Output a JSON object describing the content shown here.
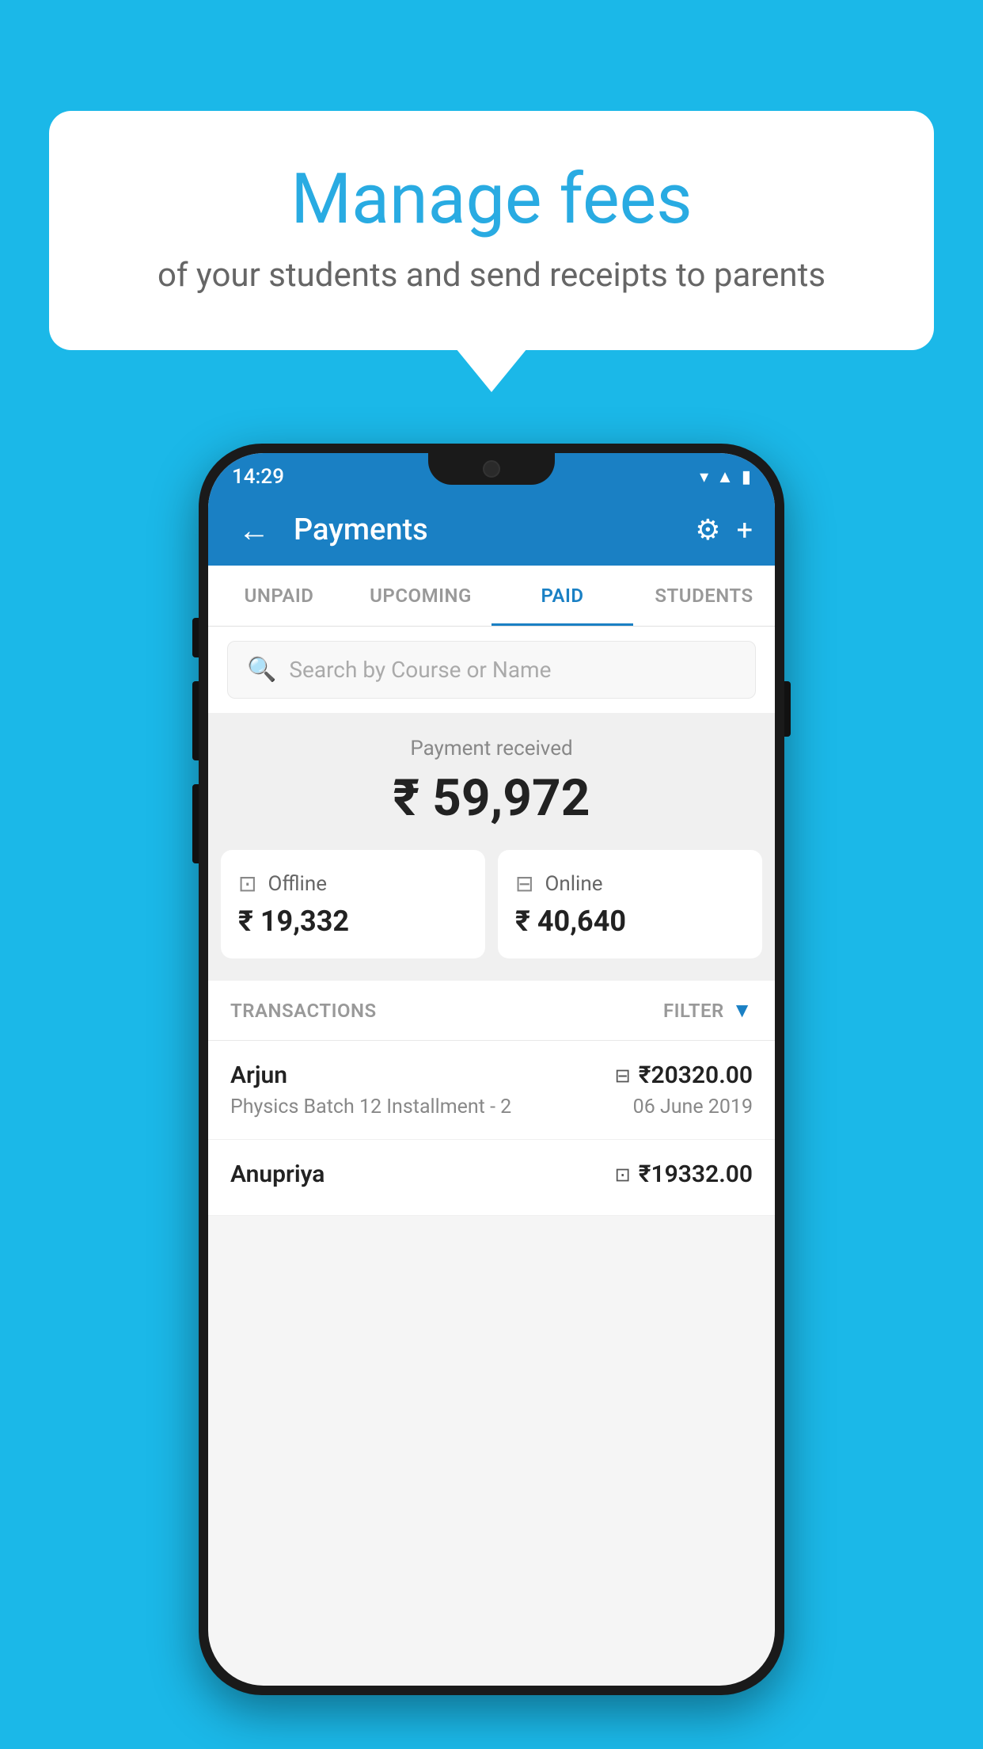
{
  "page": {
    "background_color": "#1bb8e8"
  },
  "speech_bubble": {
    "title": "Manage fees",
    "subtitle": "of your students and send receipts to parents"
  },
  "phone": {
    "status_bar": {
      "time": "14:29",
      "icons": [
        "wifi",
        "signal",
        "battery"
      ]
    },
    "app_bar": {
      "title": "Payments",
      "back_label": "←",
      "settings_label": "⚙",
      "add_label": "+"
    },
    "tabs": [
      {
        "label": "UNPAID",
        "active": false
      },
      {
        "label": "UPCOMING",
        "active": false
      },
      {
        "label": "PAID",
        "active": true
      },
      {
        "label": "STUDENTS",
        "active": false
      }
    ],
    "search": {
      "placeholder": "Search by Course or Name"
    },
    "payment_summary": {
      "label": "Payment received",
      "total": "₹ 59,972",
      "offline": {
        "label": "Offline",
        "amount": "₹ 19,332"
      },
      "online": {
        "label": "Online",
        "amount": "₹ 40,640"
      }
    },
    "transactions": {
      "header": "TRANSACTIONS",
      "filter_label": "FILTER",
      "items": [
        {
          "name": "Arjun",
          "course": "Physics Batch 12 Installment - 2",
          "amount": "₹20320.00",
          "date": "06 June 2019",
          "type": "online"
        },
        {
          "name": "Anupriya",
          "course": "",
          "amount": "₹19332.00",
          "date": "",
          "type": "offline"
        }
      ]
    }
  }
}
